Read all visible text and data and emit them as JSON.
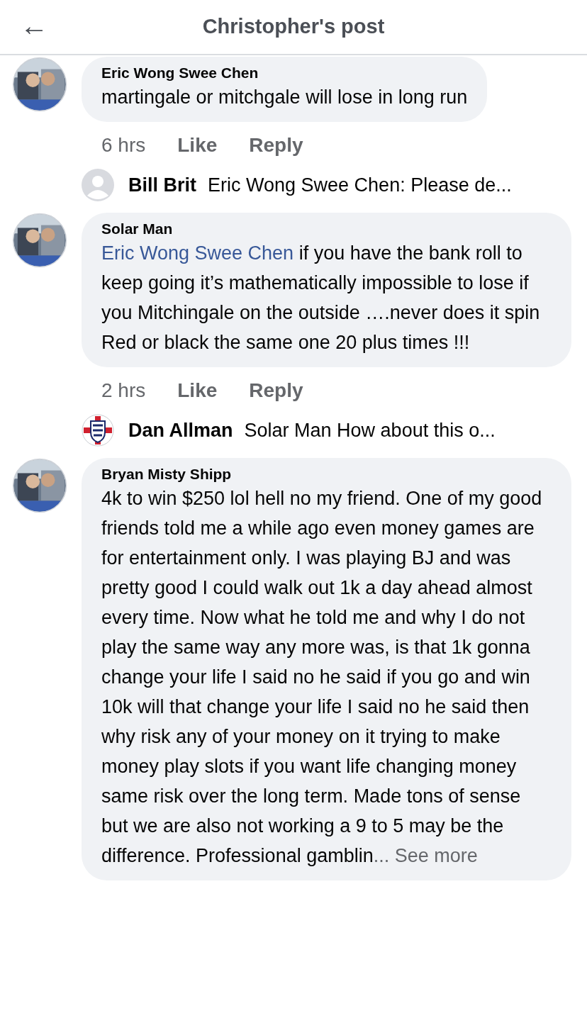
{
  "header": {
    "back": "←",
    "title": "Christopher's post"
  },
  "comments": [
    {
      "author": "Eric Wong Swee Chen",
      "text": "martingale or mitchgale will lose in long run",
      "time": "6 hrs",
      "like": "Like",
      "reply": "Reply",
      "replies": [
        {
          "author": "Bill Brit",
          "avatar": {
            "kind": "default"
          },
          "text": "Eric Wong Swee Chen: Please de..."
        }
      ]
    },
    {
      "author": "Solar Man",
      "mention": "Eric Wong Swee Chen",
      "text": " if you have the bank roll to keep going it’s mathematically impossible to lose if you Mitchingale on the outside ….never does it spin Red or black the same one 20 plus times  !!!",
      "time": "2 hrs",
      "like": "Like",
      "reply": "Reply",
      "replies": [
        {
          "author": "Dan Allman",
          "avatar": {
            "kind": "crest"
          },
          "text": "Solar Man  How about this o..."
        }
      ]
    },
    {
      "author": "Bryan Misty Shipp",
      "text": "4k to win $250 lol hell no my friend. One of my good friends told me a while ago even money games are for entertainment only. I was playing BJ and was pretty good I could walk out 1k a day ahead almost every time. Now what he told me and why I do not play the same way any more was, is that 1k gonna change your life I said no he said if you go and win 10k will that change your life I said no he said then why risk any of your money on it trying to make money play slots if you want life changing money same risk over the long term. Made tons of sense but we are also not working a 9 to 5 may be the difference. Professional gamblin",
      "more": "... See more"
    }
  ]
}
